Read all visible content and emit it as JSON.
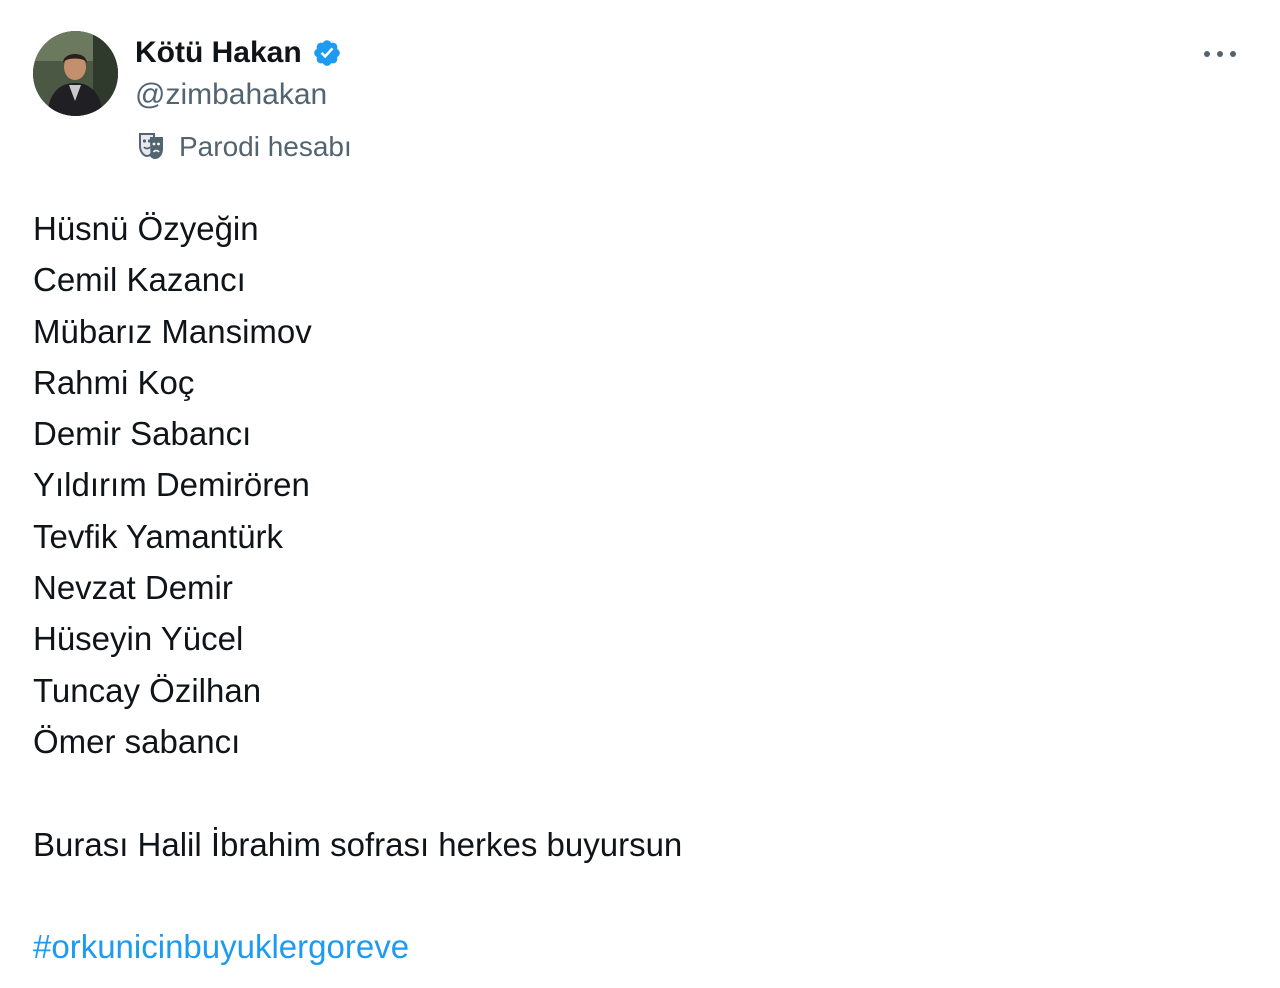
{
  "author": {
    "display_name": "Kötü Hakan",
    "handle": "@zimbahakan",
    "verified": true,
    "verified_color": "#1d9bf0",
    "parody_label": "Parodi hesabı"
  },
  "icons": {
    "verified": "verified-badge-icon",
    "parody": "parody-mask-icon",
    "more": "more-horizontal-icon"
  },
  "tweet": {
    "names": [
      "Hüsnü Özyeğin",
      "Cemil Kazancı",
      "Mübarız Mansimov",
      "Rahmi Koç",
      "Demir Sabancı",
      "Yıldırım Demirören",
      "Tevfik Yamantürk",
      "Nevzat Demir",
      "Hüseyin Yücel",
      "Tuncay Özilhan",
      "Ömer sabancı"
    ],
    "message": "Burası Halil İbrahim sofrası herkes buyursun",
    "hashtag": "#orkunicinbuyuklergoreve",
    "hashtag_color": "#1d9bf0"
  }
}
